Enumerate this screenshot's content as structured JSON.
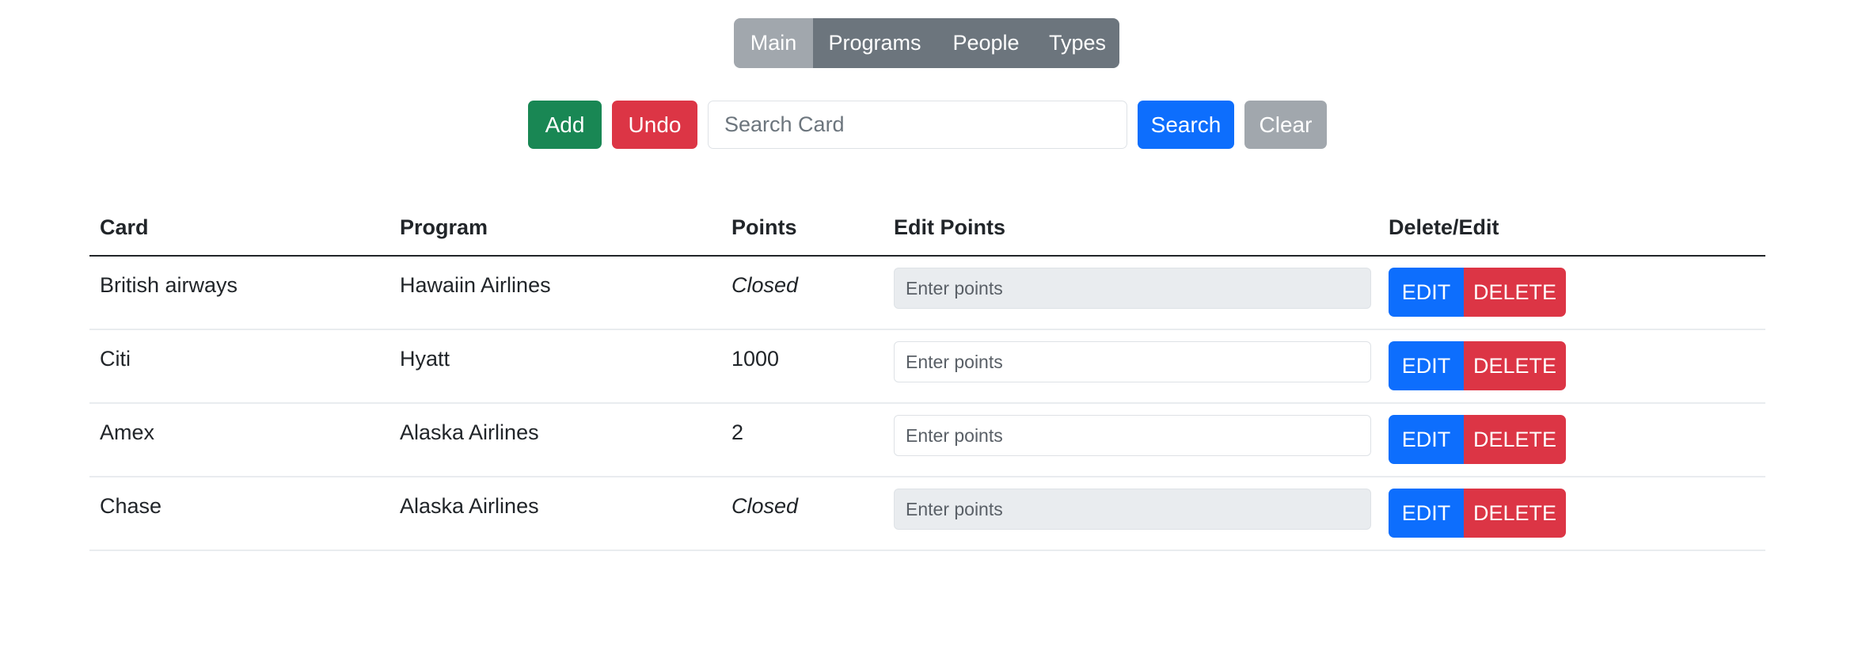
{
  "nav": {
    "tabs": [
      {
        "label": "Main",
        "active": true
      },
      {
        "label": "Programs",
        "active": false
      },
      {
        "label": "People",
        "active": false
      },
      {
        "label": "Types",
        "active": false
      }
    ]
  },
  "toolbar": {
    "add_label": "Add",
    "undo_label": "Undo",
    "search_placeholder": "Search Card",
    "search_value": "",
    "search_label": "Search",
    "clear_label": "Clear"
  },
  "table": {
    "headers": {
      "card": "Card",
      "program": "Program",
      "points": "Points",
      "edit_points": "Edit Points",
      "delete_edit": "Delete/Edit"
    },
    "rows": [
      {
        "card": "British airways",
        "program": "Hawaiin Airlines",
        "points": "Closed",
        "closed": true,
        "edit_placeholder": "Enter points",
        "edit_label": "EDIT",
        "delete_label": "DELETE"
      },
      {
        "card": "Citi",
        "program": "Hyatt",
        "points": "1000",
        "closed": false,
        "edit_placeholder": "Enter points",
        "edit_label": "EDIT",
        "delete_label": "DELETE"
      },
      {
        "card": "Amex",
        "program": "Alaska Airlines",
        "points": "2",
        "closed": false,
        "edit_placeholder": "Enter points",
        "edit_label": "EDIT",
        "delete_label": "DELETE"
      },
      {
        "card": "Chase",
        "program": "Alaska Airlines",
        "points": "Closed",
        "closed": true,
        "edit_placeholder": "Enter points",
        "edit_label": "EDIT",
        "delete_label": "DELETE"
      }
    ]
  },
  "colors": {
    "primary": "#0d6efd",
    "success": "#198754",
    "danger": "#dc3545",
    "secondary": "#6c757d",
    "secondary_light": "#a1a7ad",
    "disabled_input": "#e9ecef"
  }
}
